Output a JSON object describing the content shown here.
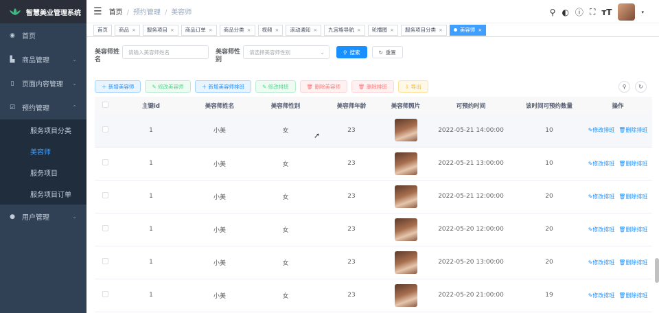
{
  "app": {
    "title": "智慧美业管理系统"
  },
  "sidebar": {
    "items": [
      {
        "label": "首页",
        "icon": "dashboard-icon"
      },
      {
        "label": "商品管理",
        "icon": "cart-icon"
      },
      {
        "label": "页面内容管理",
        "icon": "book-icon"
      },
      {
        "label": "预约管理",
        "icon": "checkbox-icon"
      },
      {
        "label": "用户管理",
        "icon": "user-icon"
      }
    ],
    "sub": [
      "服务项目分类",
      "美容师",
      "服务项目",
      "服务项目订单"
    ],
    "active_sub": "美容师"
  },
  "breadcrumb": {
    "home": "首页",
    "parent": "预约管理",
    "current": "美容师"
  },
  "tags": [
    "首页",
    "商品",
    "服务项目",
    "商品订单",
    "商品分类",
    "视频",
    "滚动通知",
    "九宫格导航",
    "轮播图",
    "服务项目分类",
    "美容师"
  ],
  "search": {
    "name_label": "美容师姓名",
    "name_placeholder": "请输入美容师姓名",
    "gender_label": "美容师性别",
    "gender_placeholder": "请选择美容师性别",
    "search_btn": "搜索",
    "reset_btn": "重置"
  },
  "toolbar": {
    "add": "新增美容师",
    "edit": "修改美容师",
    "add_schedule": "新增美容师排班",
    "edit_schedule": "修改排班",
    "delete": "删除美容师",
    "delete_schedule": "删除排班",
    "export": "导出"
  },
  "table": {
    "headers": [
      "主键id",
      "美容师姓名",
      "美容师性别",
      "美容师年龄",
      "美容师照片",
      "可预约时间",
      "该时间可预约数量",
      "操作"
    ],
    "action_edit": "修改排班",
    "action_delete": "删除排班",
    "rows": [
      {
        "id": "1",
        "name": "小美",
        "gender": "女",
        "age": "23",
        "time": "2022-05-21 14:00:00",
        "count": "10"
      },
      {
        "id": "1",
        "name": "小美",
        "gender": "女",
        "age": "23",
        "time": "2022-05-21 13:00:00",
        "count": "10"
      },
      {
        "id": "1",
        "name": "小美",
        "gender": "女",
        "age": "23",
        "time": "2022-05-21 12:00:00",
        "count": "20"
      },
      {
        "id": "1",
        "name": "小美",
        "gender": "女",
        "age": "23",
        "time": "2022-05-20 12:00:00",
        "count": "20"
      },
      {
        "id": "1",
        "name": "小美",
        "gender": "女",
        "age": "23",
        "time": "2022-05-20 13:00:00",
        "count": "20"
      },
      {
        "id": "1",
        "name": "小美",
        "gender": "女",
        "age": "23",
        "time": "2022-05-20 21:00:00",
        "count": "19"
      }
    ]
  }
}
